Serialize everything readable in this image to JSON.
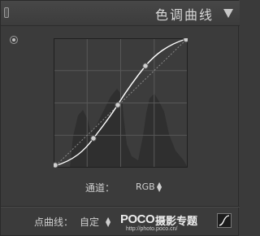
{
  "panel": {
    "title": "色调曲线",
    "collapse_icon": "triangle-down-icon",
    "toggle_icon": "panel-switch-icon"
  },
  "curve": {
    "target_tool_icon": "target-adjust-icon",
    "curve_points": [
      [
        0.0,
        0.0
      ],
      [
        0.3,
        0.22
      ],
      [
        0.5,
        0.48
      ],
      [
        0.71,
        0.78
      ],
      [
        1.0,
        1.0
      ]
    ],
    "colors": {
      "grid": "#5a5a5a",
      "background": "#3c3c3c",
      "histogram": "#2e2e2e",
      "curve": "#ffffff"
    }
  },
  "channel": {
    "label": "通道：",
    "value": "RGB"
  },
  "point_curve": {
    "label": "点曲线：",
    "value": "自定"
  },
  "watermark": {
    "logo": "POCO",
    "text": "摄影专题",
    "url": "http://photo.poco.cn/"
  },
  "edit_curve_icon": "curve-edit-icon"
}
